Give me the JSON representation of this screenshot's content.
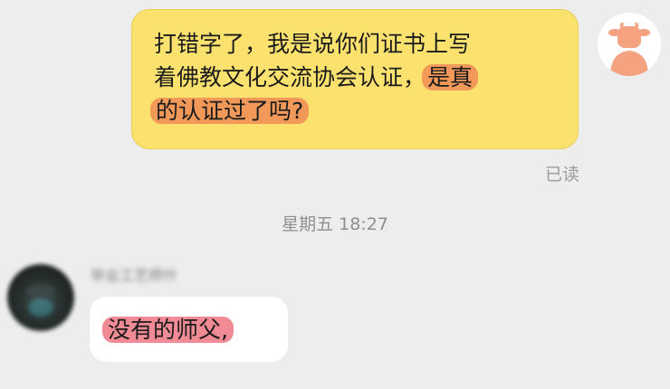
{
  "outgoing": {
    "line1": "打错字了，我是说你们证书上写",
    "line2_plain": "着佛教文化交流协会认证，",
    "line2_highlight": "是真",
    "line3_highlight": "的认证过了吗?",
    "read_status": "已读"
  },
  "timestamp": "星期五 18:27",
  "incoming": {
    "sender_name": "毕业工艺师什",
    "message": "没有的师父,"
  },
  "colors": {
    "background": "#ededed",
    "outgoing_bubble": "#fbe26f",
    "highlight_orange": "#f2995a",
    "highlight_pink": "#f08a95",
    "incoming_bubble": "#ffffff",
    "self_avatar": "#f4a27f"
  },
  "icons": {
    "self_avatar": "cow-avatar-icon"
  }
}
